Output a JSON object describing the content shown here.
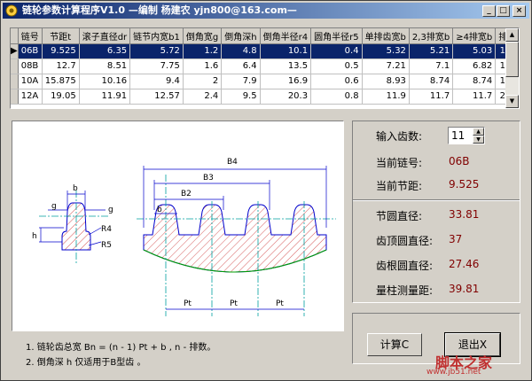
{
  "window": {
    "title": "链轮参数计算程序V1.0  —编制 杨建农 yjn800@163.com—",
    "min_label": "_",
    "max_label": "□",
    "close_label": "×"
  },
  "table": {
    "headers": [
      "链号",
      "节距t",
      "滚子直径dr",
      "链节内宽b1",
      "倒角宽g",
      "倒角深h",
      "倒角半径r4",
      "圆角半径r5",
      "单排齿宽b",
      "2,3排宽b",
      "≥4排宽b",
      "排距Pt"
    ],
    "rows": [
      [
        "06B",
        "9.525",
        "6.35",
        "5.72",
        "1.2",
        "4.8",
        "10.1",
        "0.4",
        "5.32",
        "5.21",
        "5.03",
        "10.24"
      ],
      [
        "08B",
        "12.7",
        "8.51",
        "7.75",
        "1.6",
        "6.4",
        "13.5",
        "0.5",
        "7.21",
        "7.1",
        "6.82",
        "13.92"
      ],
      [
        "10A",
        "15.875",
        "10.16",
        "9.4",
        "2",
        "7.9",
        "16.9",
        "0.6",
        "8.93",
        "8.74",
        "8.74",
        "18.11"
      ],
      [
        "12A",
        "19.05",
        "11.91",
        "12.57",
        "2.4",
        "9.5",
        "20.3",
        "0.8",
        "11.9",
        "11.7",
        "11.7",
        "22.78"
      ]
    ],
    "selected_row": 0,
    "row_indicator": "▶"
  },
  "drawing": {
    "labels": {
      "b": "b",
      "g": "g",
      "h": "h",
      "R4": "R4",
      "R5": "R5",
      "B2": "B2",
      "B3": "B3",
      "B4": "B4",
      "Pt": "Pt"
    }
  },
  "notes": [
    "1. 链轮齿总宽  Bn = (n - 1) Pt  + b , n - 排数。",
    "2. 倒角深 h 仅适用于B型齿 。"
  ],
  "info": {
    "teeth_label": "输入齿数:",
    "teeth_value": "11",
    "chain_label": "当前链号:",
    "chain_value": "06B",
    "pitch_label": "当前节距:",
    "pitch_value": "9.525",
    "pitch_circle_label": "节圆直径:",
    "pitch_circle_value": "33.81",
    "tip_circle_label": "齿顶圆直径:",
    "tip_circle_value": "37",
    "root_circle_label": "齿根圆直径:",
    "root_circle_value": "27.46",
    "measure_label": "量柱测量距:",
    "measure_value": "39.81"
  },
  "buttons": {
    "calc_label": "计算C",
    "exit_label": "退出X"
  },
  "watermark": {
    "text": "脚本之家",
    "url": "www.jb51.net"
  },
  "colors": {
    "title_start": "#0a246a",
    "selected_row": "#0a246a",
    "value_text": "#800000",
    "drawing_lines": "#0000cc",
    "center_lines": "#00a0a0",
    "hatch": "#cc0000"
  }
}
